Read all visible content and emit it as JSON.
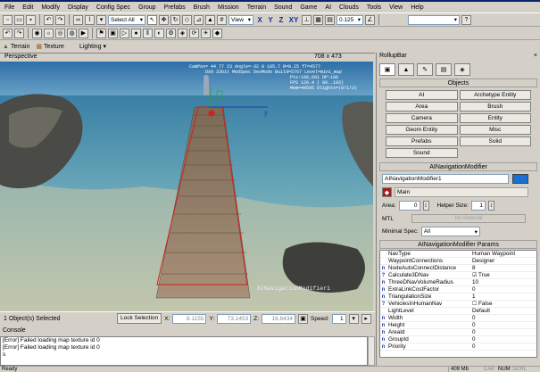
{
  "menu": [
    "File",
    "Edit",
    "Modify",
    "Display",
    "Config Spec",
    "Group",
    "Prefabs",
    "Brush",
    "Mission",
    "Terrain",
    "Sound",
    "Game",
    "AI",
    "Clouds",
    "Tools",
    "View",
    "Help"
  ],
  "toolbar": {
    "select_label": "Select All",
    "view_label": "View",
    "axis_x": "X",
    "axis_y": "Y",
    "axis_z": "Z",
    "axis_xy": "XY",
    "snap_value": "0.125"
  },
  "tabs": {
    "terrain": "Terrain",
    "texture": "Texture",
    "lighting": "Lighting"
  },
  "viewport": {
    "title": "Perspective",
    "resolution": "708 x 473",
    "hud": [
      "CamPos= 44  77  23 Angle=-32  0 185.7  R=0.25 fT=4577",
      "DX9 32bit MedSpec DevMode Build=5767 Level=mini_map",
      "Pts:108,601  DP:188",
      "FPS 120.4 (  80..193)",
      "Mem=40595 Dlights=(0/1/3)"
    ],
    "object_label": "AINavigationModifier1",
    "axis_y_label": "y"
  },
  "status": {
    "selected": "1 Object(s) Selected",
    "lock_label": "Lock Selection",
    "x_label": "X:",
    "x_value": "8.1155",
    "y_label": "Y:",
    "y_value": "73.1453",
    "z_label": "Z:",
    "z_value": "16.6434",
    "speed_label": "Speed:",
    "speed_value": "1"
  },
  "console": {
    "title": "Console",
    "lines": [
      "[Error] Failed loading map texture id 0",
      "[Error] Failed loading map texture id 0"
    ],
    "prompt": "s"
  },
  "statusbar": {
    "ready": "Ready",
    "mem": "409 Mb",
    "cap": "CAP",
    "num": "NUM",
    "scrl": "SCRL"
  },
  "rollup": {
    "title": "RollupBar",
    "objects_header": "Objects",
    "buttons": [
      "AI",
      "Archetype Entity",
      "Area",
      "Brush",
      "Camera",
      "Entity",
      "Geom Entity",
      "Misc",
      "Prefabs",
      "Solid",
      "Sound"
    ],
    "modifier_header": "AINavigationModifier",
    "name_value": "AINavigationModifier1",
    "layer_label": "Main",
    "area_label": "Area:",
    "area_value": "0",
    "helper_label": "Helper Size:",
    "helper_value": "1",
    "mtl_label": "MTL",
    "mtl_value": "No Material",
    "minspec_label": "Minimal Spec:",
    "minspec_value": "All",
    "params_header": "AINavigationModifier Params",
    "params": [
      {
        "name": "NavType",
        "value": "Human Waypoint",
        "icon": ""
      },
      {
        "name": "WaypointConnections",
        "value": "Designer",
        "icon": ""
      },
      {
        "name": "NodeAutoConnectDistance",
        "value": "8",
        "icon": "n"
      },
      {
        "name": "Calculate3DNav",
        "value": "True",
        "icon": "?"
      },
      {
        "name": "ThreeDNavVolumeRadius",
        "value": "10",
        "icon": "n"
      },
      {
        "name": "ExtraLinkCostFactor",
        "value": "0",
        "icon": "n"
      },
      {
        "name": "TriangulationSize",
        "value": "1",
        "icon": "n"
      },
      {
        "name": "VehiclesInHumanNav",
        "value": "False",
        "icon": "?"
      },
      {
        "name": "LightLevel",
        "value": "Default",
        "icon": ""
      },
      {
        "name": "Width",
        "value": "0",
        "icon": "n"
      },
      {
        "name": "Height",
        "value": "0",
        "icon": "n"
      },
      {
        "name": "AreaId",
        "value": "0",
        "icon": "n"
      },
      {
        "name": "GroupId",
        "value": "0",
        "icon": "n"
      },
      {
        "name": "Priority",
        "value": "0",
        "icon": "n"
      }
    ]
  },
  "colors": {
    "accent": "#0a246a",
    "swatch": "#1a6fd6",
    "selection": "#d02020"
  }
}
